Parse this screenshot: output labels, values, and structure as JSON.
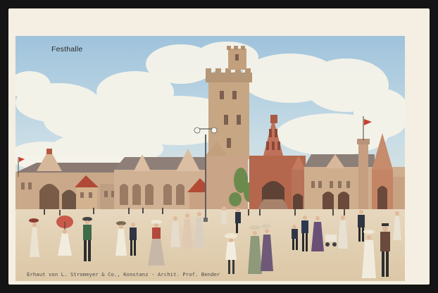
{
  "postcard": {
    "title": "Festhalle",
    "imprint": "Erhaut von L. Stromeyer & Co., Konstanz - Archit. Prof. Bender"
  }
}
